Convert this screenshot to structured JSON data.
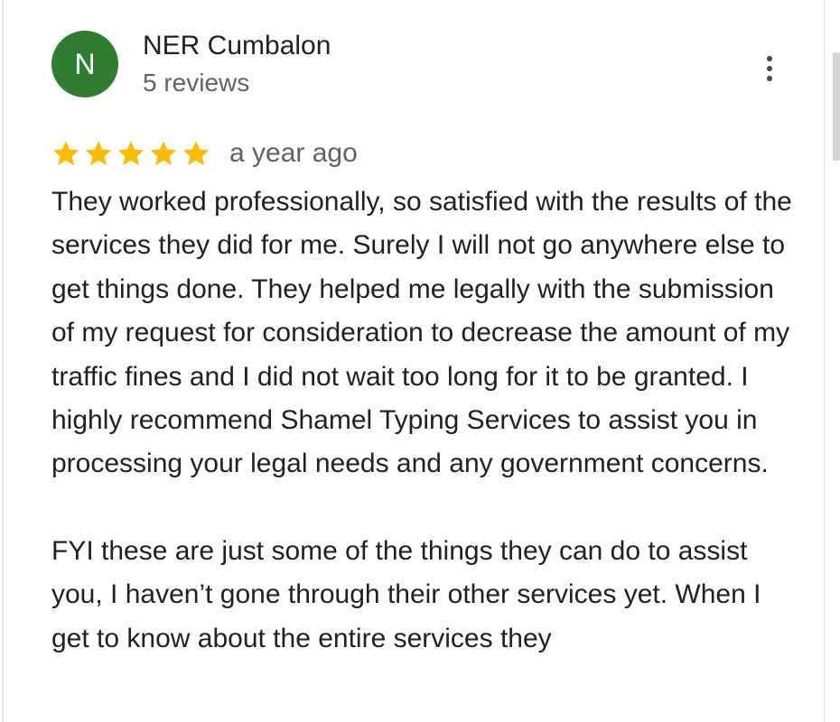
{
  "reviewer": {
    "initial": "N",
    "name": "NER Cumbalon",
    "review_count": "5 reviews",
    "avatar_color": "#2e7d32"
  },
  "review": {
    "rating": 5,
    "rating_max": 5,
    "star_color": "#fbbc04",
    "date": "a year ago",
    "paragraphs": [
      "They worked professionally, so satisfied with the results of the services they did for me. Surely I will not go anywhere else to get things done. They helped me legally with the submission of my request for consideration to decrease the amount of my traffic fines and I did not wait too long for it to be granted. I highly recommend Shamel Typing Services to assist you in processing your legal needs and any government concerns.",
      "FYI these are just some of the things they can do to assist you, I haven’t gone through their other services yet. When I get to know about the entire services they"
    ]
  },
  "icons": {
    "more_options": "more-vert-icon",
    "star": "star-icon"
  }
}
